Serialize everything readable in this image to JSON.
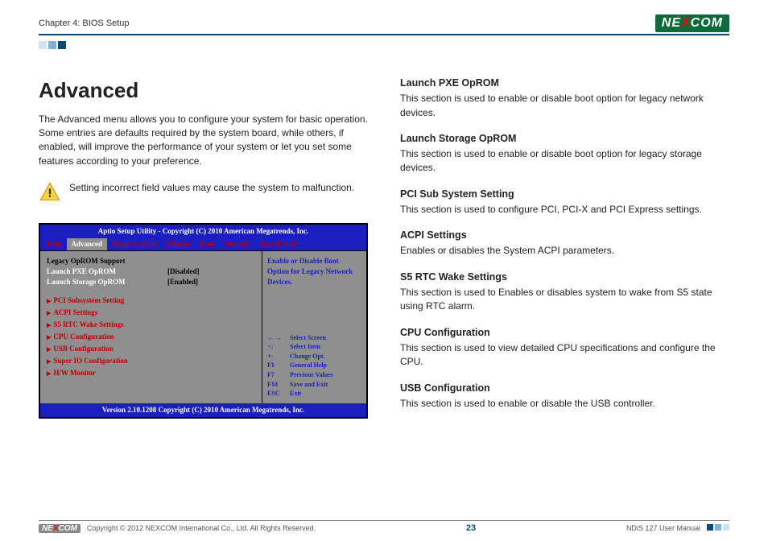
{
  "header": {
    "chapter": "Chapter 4: BIOS Setup",
    "logo_a": "NE",
    "logo_x": "X",
    "logo_b": "COM"
  },
  "left": {
    "title": "Advanced",
    "intro": "The Advanced menu allows you to configure your system for basic operation. Some entries are defaults required by the system board, while others, if enabled, will improve the performance of your system or let you set some features according to your preference.",
    "warning": "Setting incorrect field values may cause the system to malfunction."
  },
  "bios": {
    "title": "Aptio Setup Utility - Copyright (C) 2010 American Megatrends, Inc.",
    "tabs": [
      "Main",
      "Advanced",
      "Magic Control",
      "Chipset",
      "Boot",
      "Security",
      "Save & Exit"
    ],
    "legacy_header": "Legacy OpROM Support",
    "rows": [
      {
        "label": "Launch PXE OpROM",
        "value": "[Disabled]"
      },
      {
        "label": "Launch Storage OpROM",
        "value": "[Enabled]"
      }
    ],
    "subs": [
      "PCI Subsystem Setting",
      "ACPI Settings",
      "S5 RTC Wake Settings",
      "CPU Configuration",
      "USB Configuration",
      "Super IO Configuration",
      "H/W Monitor"
    ],
    "right_top": "Enable or Disable Boot Option for Legacy Network Devices.",
    "help": [
      {
        "k": "← →",
        "v": "Select Screen"
      },
      {
        "k": "↑↓",
        "v": "Select Item"
      },
      {
        "k": "+-",
        "v": "Change Opt."
      },
      {
        "k": "F1",
        "v": "General Help"
      },
      {
        "k": "F7",
        "v": "Previous Values"
      },
      {
        "k": "F10",
        "v": "Save and Exit"
      },
      {
        "k": "ESC",
        "v": "Exit"
      }
    ],
    "footer": "Version 2.10.1208 Copyright (C) 2010 American Megatrends, Inc."
  },
  "right": [
    {
      "h": "Launch PXE OpROM",
      "p": "This section is used to enable or disable boot option for legacy network devices."
    },
    {
      "h": "Launch Storage OpROM",
      "p": "This section is used to enable or disable boot option for legacy storage devices."
    },
    {
      "h": "PCI Sub System Setting",
      "p": "This section is used to configure PCI, PCI-X and PCI Express settings."
    },
    {
      "h": "ACPI Settings",
      "p": "Enables or disables the System ACPI parameters."
    },
    {
      "h": "S5 RTC Wake Settings",
      "p": "This section is used to Enables or disables system to wake from S5 state using RTC alarm."
    },
    {
      "h": "CPU Configuration",
      "p": "This section is used to view detailed CPU specifications and configure the CPU."
    },
    {
      "h": "USB Configuration",
      "p": "This section is used to enable or disable the USB controller."
    }
  ],
  "footer": {
    "copyright": "Copyright © 2012 NEXCOM International Co., Ltd. All Rights Reserved.",
    "page": "23",
    "manual": "NDiS 127 User Manual"
  }
}
